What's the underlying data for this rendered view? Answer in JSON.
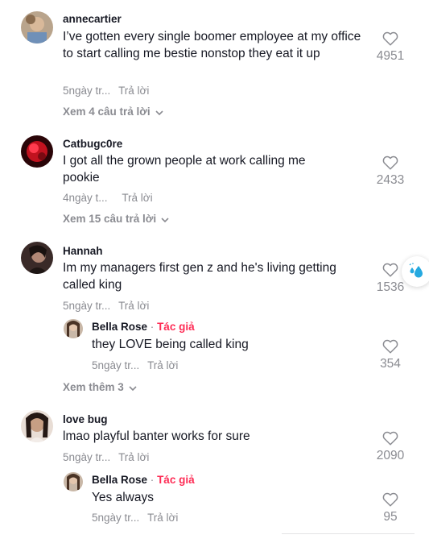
{
  "comments": [
    {
      "username": "annecartier",
      "text": "I’ve gotten every single boomer employee at my office to start calling me bestie nonstop they eat it up",
      "time": "5ngày tr...",
      "reply": "Trả lời",
      "likes": "4951",
      "view_replies": "Xem 4 câu trả lời"
    },
    {
      "username": "Catbugc0re",
      "text": "I got all the grown people at work calling me pookie",
      "time": "4ngày t...",
      "reply": "Trả lời",
      "likes": "2433",
      "view_replies": "Xem 15 câu trả lời"
    },
    {
      "username": "Hannah",
      "text": "Im my managers first gen z and he's living getting called king",
      "time": "5ngày tr...",
      "reply": "Trả lời",
      "likes": "1536",
      "reply_item": {
        "username": "Bella Rose",
        "separator": "·",
        "author_tag": "Tác giả",
        "text": "they LOVE being called king",
        "time": "5ngày tr...",
        "reply": "Trả lời",
        "likes": "354"
      },
      "view_more": "Xem thêm 3"
    },
    {
      "username": "love bug",
      "text": "lmao playful banter works for sure",
      "time": "5ngày tr...",
      "reply": "Trả lời",
      "likes": "2090",
      "reply_item": {
        "username": "Bella Rose",
        "separator": "·",
        "author_tag": "Tác giả",
        "text": "Yes always",
        "time": "5ngày tr...",
        "reply": "Trả lời",
        "likes": "95"
      }
    }
  ],
  "icons": {
    "like": "heart-outline-icon",
    "expand": "chevron-down-icon",
    "floating": "water-drops-icon"
  },
  "colors": {
    "text": "#161823",
    "muted": "#8a8b91",
    "author_tag": "#fe2c55",
    "floating_icon": "#25a9e0"
  }
}
